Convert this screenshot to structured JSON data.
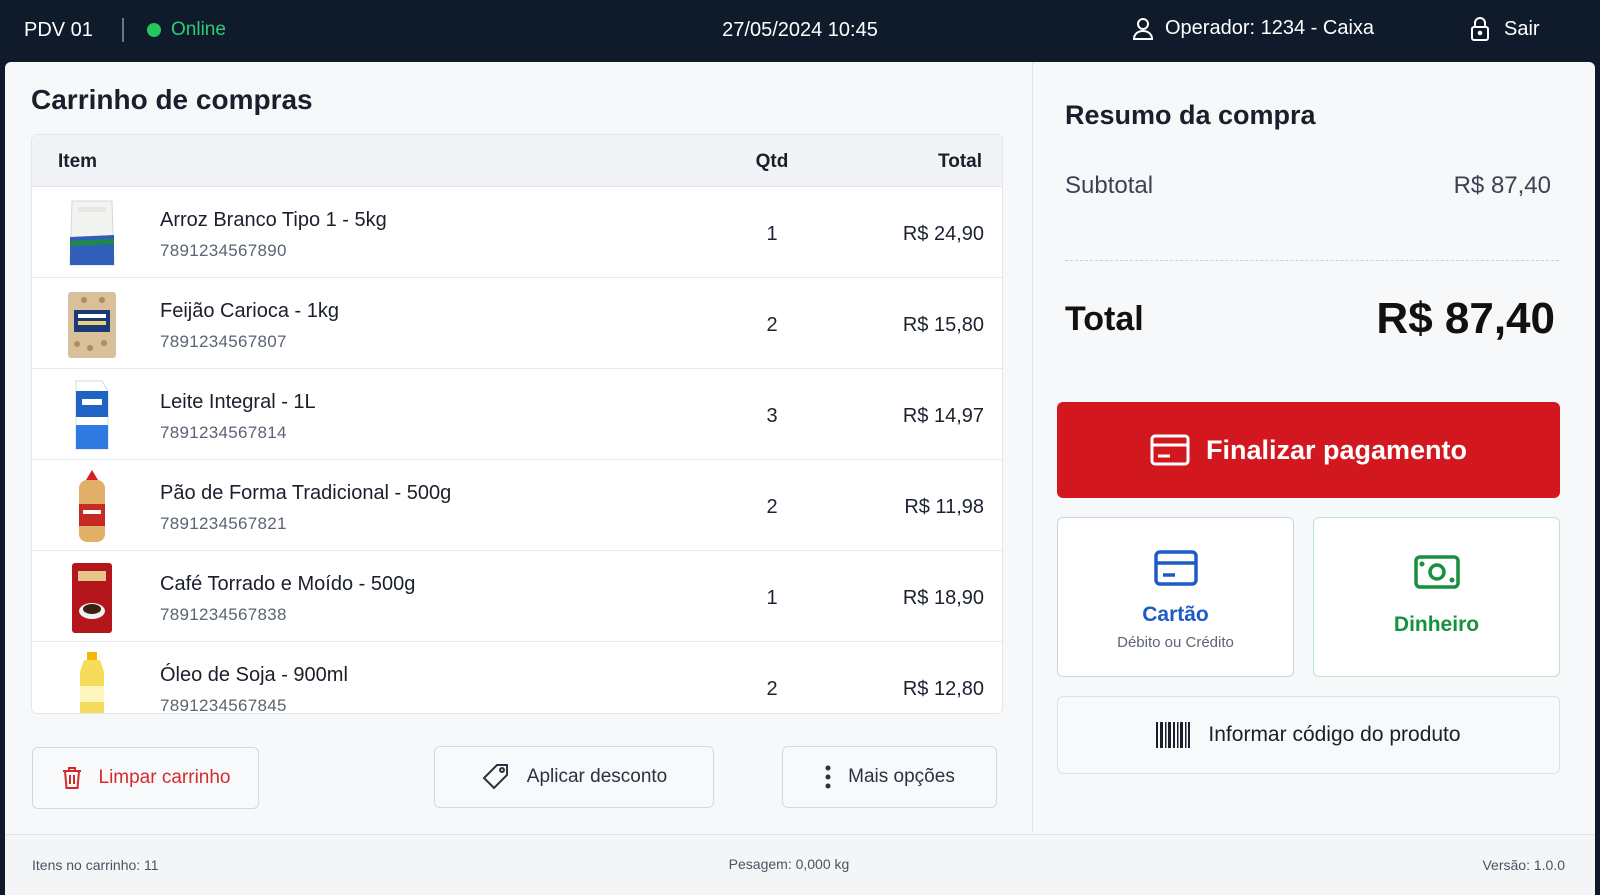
{
  "topbar": {
    "terminal": "PDV 01",
    "status": "Online",
    "datetime": "27/05/2024 10:45",
    "operator": "Operador: 1234 - Caixa",
    "logout": "Sair"
  },
  "cart": {
    "title": "Carrinho de compras",
    "columns": {
      "item": "Item",
      "qty": "Qtd",
      "total": "Total"
    },
    "items": [
      {
        "name": "Arroz Branco Tipo 1 - 5kg",
        "code": "7891234567890",
        "qty": "1",
        "total": "R$ 24,90"
      },
      {
        "name": "Feijão Carioca - 1kg",
        "code": "7891234567807",
        "qty": "2",
        "total": "R$ 15,80"
      },
      {
        "name": "Leite Integral - 1L",
        "code": "7891234567814",
        "qty": "3",
        "total": "R$ 14,97"
      },
      {
        "name": "Pão de Forma Tradicional - 500g",
        "code": "7891234567821",
        "qty": "2",
        "total": "R$ 11,98"
      },
      {
        "name": "Café Torrado e Moído - 500g",
        "code": "7891234567838",
        "qty": "1",
        "total": "R$ 18,90"
      },
      {
        "name": "Óleo de Soja - 900ml",
        "code": "7891234567845",
        "qty": "2",
        "total": "R$ 12,80"
      }
    ],
    "actions": {
      "clear": "Limpar carrinho",
      "discount": "Aplicar desconto",
      "more": "Mais opções"
    }
  },
  "summary": {
    "title": "Resumo da compra",
    "subtotal_label": "Subtotal",
    "subtotal_value": "R$ 87,40",
    "total_label": "Total",
    "total_value": "R$ 87,40",
    "finalize": "Finalizar pagamento",
    "card_label": "Cartão",
    "card_sub": "Débito ou Crédito",
    "cash_label": "Dinheiro",
    "product_code": "Informar código do produto"
  },
  "footer": {
    "items_count": "Itens no carrinho: 11",
    "weight": "Pesagem: 0,000 kg",
    "version": "Versão: 1.0.0"
  },
  "colors": {
    "topbar_bg": "#0f1a2b",
    "online": "#22c55e",
    "finalize_bg": "#d3171f",
    "card_accent": "#1f5bc7",
    "cash_accent": "#17913f",
    "danger": "#d62a2a"
  }
}
